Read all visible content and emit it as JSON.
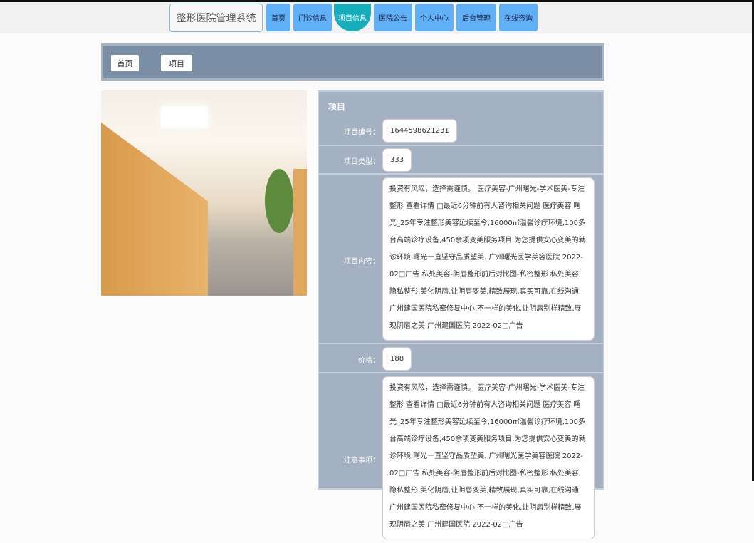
{
  "header": {
    "title": "整形医院管理系统",
    "nav": [
      "首页",
      "门诊信息",
      "项目信息",
      "医院公告",
      "个人中心",
      "后台管理",
      "在线咨询"
    ],
    "active_index": 2
  },
  "breadcrumb": [
    "首页",
    "项目"
  ],
  "detail": {
    "title": "项目",
    "fields": {
      "code_label": "项目编号：",
      "code": "1644598621231",
      "type_label": "项目类型：",
      "type": "333",
      "content_label": "项目内容：",
      "content": "投资有风险，选择需谨慎。 医疗美容-广州曙光-学术医美-专注整形 查看详情 □最近6分钟前有人咨询相关问题 医疗美容 曙光_25年专注整形美容延续至今,16000㎡温馨诊疗环境,100多台高端诊疗设备,450余项变美服务项目,为您提供安心变美的就诊环境,曙光一直坚守品质塑美. 广州曙光医学美容医院 2022-02□广告 私处美容-阴唇整形前后对比图-私密整形 私处美容,隐私整形,美化阴唇,让阴唇变美,精致展现,真实可靠,在线沟通,广州建国医院私密修复中心,不一样的美化,让阴唇别样精致,展现阴唇之美 广州建国医院 2022-02□广告",
      "price_label": "价格：",
      "price": "188",
      "notes_label": "注意事项：",
      "notes": "投资有风险，选择需谨慎。 医疗美容-广州曙光-学术医美-专注整形 查看详情 □最近6分钟前有人咨询相关问题 医疗美容 曙光_25年专注整形美容延续至今,16000㎡温馨诊疗环境,100多台高端诊疗设备,450余项变美服务项目,为您提供安心变美的就诊环境,曙光一直坚守品质塑美. 广州曙光医学美容医院 2022-02□广告 私处美容-阴唇整形前后对比图-私密整形 私处美容,隐私整形,美化阴唇,让阴唇变美,精致展现,真实可靠,在线沟通,广州建国医院私密修复中心,不一样的美化,让阴唇别样精致,展现阴唇之美 广州建国医院 2022-02□广告"
    }
  }
}
